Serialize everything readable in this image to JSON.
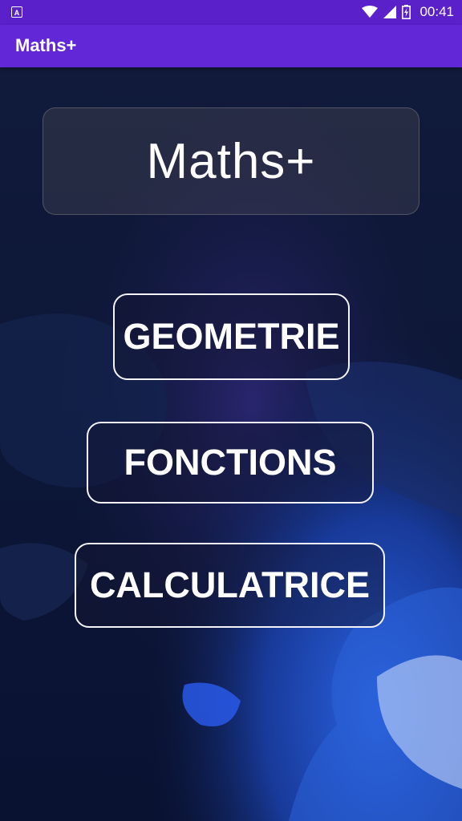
{
  "status_bar": {
    "app_icon_letter": "A",
    "time": "00:41",
    "icons": [
      "wifi-icon",
      "cell-signal-icon",
      "battery-charging-icon"
    ]
  },
  "app_bar": {
    "title": "Maths+"
  },
  "main": {
    "title": "Maths+",
    "buttons": [
      {
        "label": "GEOMETRIE"
      },
      {
        "label": "FONCTIONS"
      },
      {
        "label": "CALCULATRICE"
      }
    ]
  },
  "colors": {
    "status_bar": "#5a20c9",
    "app_bar": "#6228d7",
    "background_dark": "#0b1330",
    "background_blue": "#1d4fc4"
  }
}
